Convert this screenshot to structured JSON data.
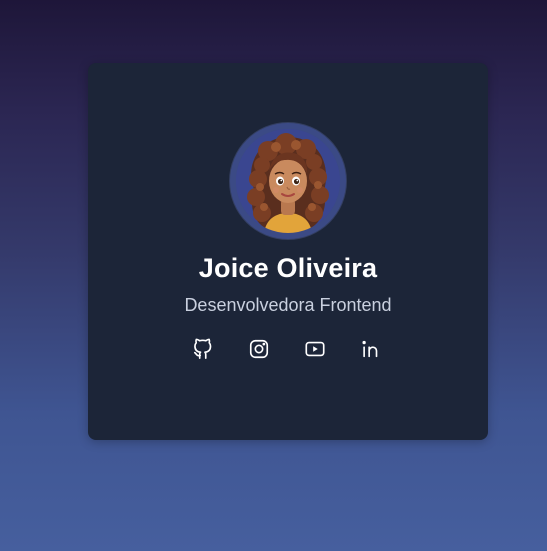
{
  "profile": {
    "name": "Joice Oliveira",
    "role": "Desenvolvedora Frontend",
    "avatar_icon": "avatar-illustration"
  },
  "socials": [
    {
      "icon": "github-icon"
    },
    {
      "icon": "instagram-icon"
    },
    {
      "icon": "youtube-icon"
    },
    {
      "icon": "linkedin-icon"
    }
  ],
  "colors": {
    "card_background": "#1c2538",
    "avatar_ring": "#3b4a85",
    "name_text": "#ffffff",
    "role_text": "#c9d0df",
    "gradient_top": "#1e1639",
    "gradient_bottom": "#465f9e"
  }
}
